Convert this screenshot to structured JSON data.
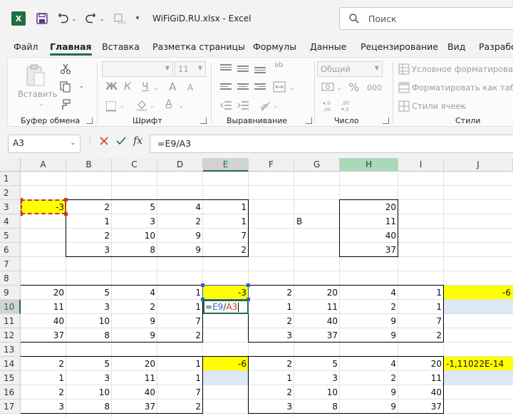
{
  "app": {
    "title": "WiFiGiD.RU.xlsx  -  Excel",
    "logo_letter": "X",
    "search_placeholder": "Поиск"
  },
  "tabs": [
    "Файл",
    "Главная",
    "Вставка",
    "Разметка страницы",
    "Формулы",
    "Данные",
    "Рецензирование",
    "Вид",
    "Разрабо"
  ],
  "active_tab": "Главная",
  "ribbon": {
    "paste_label": "Вставить",
    "font_name": "",
    "font_size": "11",
    "number_format": "Общий",
    "bold": "Ж",
    "italic": "К",
    "underline": "Ч",
    "font_grow": "A",
    "font_shrink": "A",
    "font_color_letter": "A",
    "wrap_label": "ab",
    "percent_label": "%",
    "thousands_label": "000",
    "inc_decimal": "←,0 ,00",
    "cond_format": "Условное форматирование",
    "format_table": "Форматировать как таблицу",
    "cell_styles": "Стили ячеек",
    "groups": {
      "clipboard": "Буфер обмена",
      "font": "Шрифт",
      "alignment": "Выравнивание",
      "number": "Число",
      "styles": "Стили"
    }
  },
  "formula_bar": {
    "name_box": "A3",
    "fx": "fx",
    "formula": "=E9/A3"
  },
  "columns": [
    "A",
    "B",
    "C",
    "D",
    "E",
    "F",
    "G",
    "H",
    "I",
    "J"
  ],
  "rows": [
    "1",
    "2",
    "3",
    "4",
    "5",
    "6",
    "7",
    "8",
    "9",
    "10",
    "11",
    "12",
    "13",
    "14",
    "15",
    "16",
    "17"
  ],
  "cells": {
    "A3": "-3",
    "B3": "2",
    "C3": "5",
    "D3": "4",
    "E3": "1",
    "H3": "20",
    "B4": "1",
    "C4": "3",
    "D4": "2",
    "E4": "1",
    "G4": "B",
    "H4": "11",
    "B5": "2",
    "C5": "10",
    "D5": "9",
    "E5": "7",
    "H5": "40",
    "B6": "3",
    "C6": "8",
    "D6": "9",
    "E6": "2",
    "H6": "37",
    "A9": "20",
    "B9": "5",
    "C9": "4",
    "D9": "1",
    "E9": "-3",
    "F9": "2",
    "G9": "20",
    "H9": "4",
    "I9": "1",
    "J9": "-6",
    "A10": "11",
    "B10": "3",
    "C10": "2",
    "D10": "1",
    "F10": "1",
    "G10": "11",
    "H10": "2",
    "I10": "1",
    "A11": "40",
    "B11": "10",
    "C11": "9",
    "D11": "7",
    "F11": "2",
    "G11": "40",
    "H11": "9",
    "I11": "7",
    "A12": "37",
    "B12": "8",
    "C12": "9",
    "D12": "2",
    "F12": "3",
    "G12": "37",
    "H12": "9",
    "I12": "2",
    "A14": "2",
    "B14": "5",
    "C14": "20",
    "D14": "1",
    "E14": "-6",
    "F14": "2",
    "G14": "5",
    "H14": "4",
    "I14": "20",
    "J14": "-1,11022E-14",
    "A15": "1",
    "B15": "3",
    "C15": "11",
    "D15": "1",
    "F15": "1",
    "G15": "3",
    "H15": "2",
    "I15": "11",
    "A16": "2",
    "B16": "10",
    "C16": "40",
    "D16": "7",
    "F16": "2",
    "G16": "10",
    "H16": "9",
    "I16": "40",
    "A17": "3",
    "B17": "8",
    "C17": "37",
    "D17": "2",
    "F17": "3",
    "G17": "8",
    "H17": "9",
    "I17": "37"
  },
  "editing": {
    "cell": "E10",
    "part_eq": "=",
    "part_ref1": "E9",
    "part_op": "/",
    "part_ref2": "A3"
  },
  "colors": {
    "accent": "#1d6f42",
    "yellow": "#ffff00",
    "ref_blue": "#2f5fc8",
    "ref_red": "#c0392b",
    "light_blue": "#dde9f6"
  }
}
